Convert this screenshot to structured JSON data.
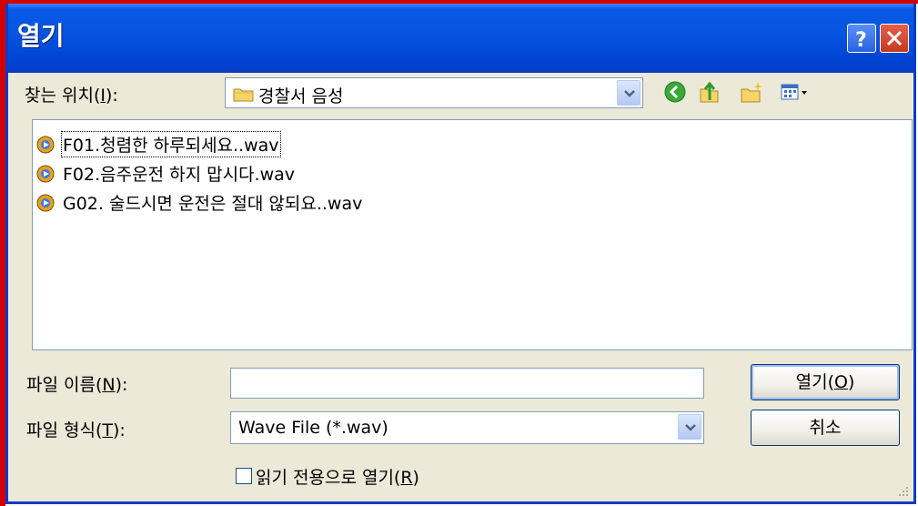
{
  "window": {
    "title": "열기"
  },
  "toolbar": {
    "lookin_label_pre": "찾는 위치(",
    "lookin_label_key": "I",
    "lookin_label_post": "):",
    "lookin_value": "경찰서 음성",
    "icons": [
      "back-icon",
      "up-folder-icon",
      "new-folder-icon",
      "view-menu-icon"
    ]
  },
  "files": [
    {
      "name": "F01.청렴한 하루되세요..wav"
    },
    {
      "name": "F02.음주운전 하지 맙시다.wav"
    },
    {
      "name": "G02. 술드시면 운전은 절대 않되요..wav"
    }
  ],
  "filename": {
    "label_pre": "파일 이름(",
    "label_key": "N",
    "label_post": "):",
    "value": ""
  },
  "filetype": {
    "label_pre": "파일 형식(",
    "label_key": "T",
    "label_post": "):",
    "value": "Wave File (*.wav)"
  },
  "buttons": {
    "open_pre": "열기(",
    "open_key": "O",
    "open_post": ")",
    "cancel": "취소"
  },
  "readonly": {
    "label_pre": "읽기 전용으로 열기(",
    "label_key": "R",
    "label_post": ")",
    "checked": false
  },
  "colors": {
    "titlebar": "#0a5ae8",
    "dialog_bg": "#ece9d8",
    "border": "#7f9db9",
    "close_red": "#c23a20"
  }
}
